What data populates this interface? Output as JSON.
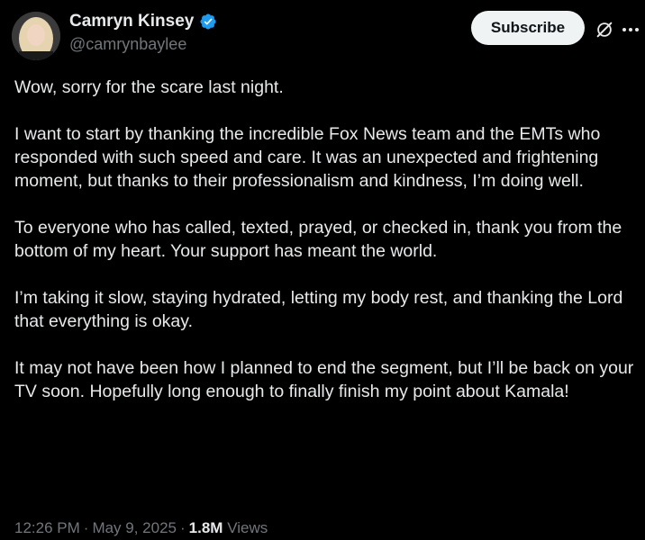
{
  "author": {
    "display_name": "Camryn Kinsey",
    "handle": "@camrynbaylee",
    "verified": true
  },
  "actions": {
    "subscribe_label": "Subscribe",
    "grok_icon": "grok-icon",
    "more_icon": "more-icon"
  },
  "tweet": {
    "paragraphs": [
      "Wow, sorry for the scare last night.",
      "I want to start by thanking the incredible Fox News team and the EMTs who responded with such speed and care. It was an unexpected and frightening moment, but thanks to their professionalism and kindness, I’m doing well.",
      "To everyone who has called, texted, prayed, or checked in, thank you from the bottom of my heart. Your support has meant the world.",
      "I’m taking it slow, staying hydrated, letting my body rest, and thanking the Lord that everything is okay.",
      "It may not have been how I planned to end the segment, but I’ll be back on your TV soon. Hopefully long enough to finally finish my point about Kamala!"
    ]
  },
  "meta": {
    "time": "12:26 PM",
    "date": "May 9, 2025",
    "views_count": "1.8M",
    "views_label": "Views"
  },
  "colors": {
    "background": "#000000",
    "text": "#e7e9ea",
    "secondary_text": "#71767b",
    "verified_badge": "#1d9bf0",
    "subscribe_bg": "#eff3f4"
  }
}
